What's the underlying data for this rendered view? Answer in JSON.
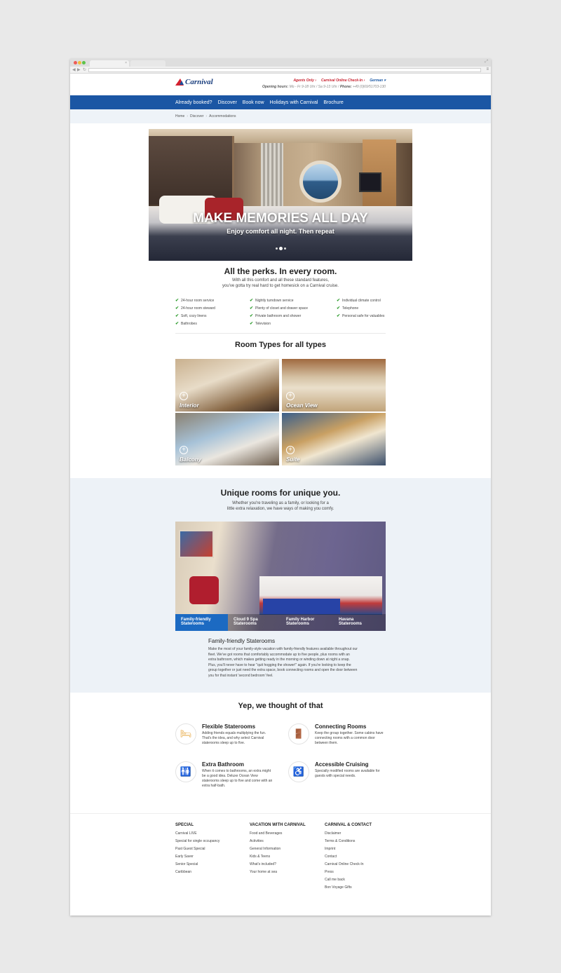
{
  "browser": {
    "tab_close": "×",
    "expand_glyph": "⤢",
    "back_glyph": "◀",
    "forward_glyph": "▶",
    "reload_glyph": "↻",
    "menu_glyph": "≡"
  },
  "header": {
    "logo_text": "Carnival",
    "links": [
      "Agents Only ›",
      "Carnival Online Check-In ›",
      "German ▾"
    ],
    "hours_label": "Opening hours:",
    "hours_text": "Mo - Fr 9-18 Uhr / Sa 9-13 Uhr",
    "phone_label": "Phone:",
    "phone": "+49 (0)69/51703-130"
  },
  "nav": [
    "Already booked?",
    "Discover",
    "Book now",
    "Holidays with Carnival",
    "Brochure"
  ],
  "breadcrumb": [
    "Home",
    "Discover",
    "Accommodations"
  ],
  "breadcrumb_sep": "›",
  "hero": {
    "title": "MAKE MEMORIES ALL DAY",
    "subtitle": "Enjoy comfort all night. Then repeat",
    "slides": 3,
    "active_slide": 2
  },
  "perks": {
    "title": "All the perks. In every room.",
    "desc_line1": "With all this comfort and all these standard features,",
    "desc_line2": "you've gotta try real hard to get homesick on a Carnival cruise.",
    "check": "✔",
    "items": [
      "24-hour room service",
      "Nightly turndown service",
      "Individual climate control",
      "24-hour room steward",
      "Plenty of closet and drawer space",
      "Telephone",
      "Soft, cozy linens",
      "Private bathroom and shower",
      "Personal safe for valuables",
      "Bathrobes",
      "Television",
      ""
    ]
  },
  "room_types": {
    "title": "Room Types for all types",
    "plus": "+",
    "rooms": [
      "Interior",
      "Ocean View",
      "Balcony",
      "Suite"
    ]
  },
  "unique": {
    "title": "Unique rooms for unique you.",
    "desc_line1": "Whether you're traveling as a family, or looking for a",
    "desc_line2": "little extra relaxation, we have ways of making you comfy.",
    "tabs": [
      {
        "line1": "Family-friendly",
        "line2": "Staterooms"
      },
      {
        "line1": "Cloud 9 Spa",
        "line2": "Staterooms"
      },
      {
        "line1": "Family Harbor",
        "line2": "Staterooms"
      },
      {
        "line1": "Havana",
        "line2": "Staterooms"
      }
    ],
    "active_tab": 0,
    "subtitle": "Family-friendly Staterooms",
    "text": "Make the most of your family-style vacation with family-friendly features available throughout our fleet. We've got rooms that comfortably accommodate up to five people, plus rooms with an extra bathroom, which makes getting ready in the morning or winding down at night a snap. Plus, you'll never have to hear \"quit hogging the shower!\" again. If you're looking to keep the group together or just need the extra space, book connecting rooms and open the door between you for that instant 'second bedroom' feel."
  },
  "features": {
    "title": "Yep, we thought of that",
    "items": [
      {
        "icon": "bed-icon",
        "glyph": "🛏",
        "title": "Flexible Staterooms",
        "text": "Adding friends equals multiplying the fun. That's the idea, and why select Carnival staterooms sleep up to five."
      },
      {
        "icon": "door-icon",
        "glyph": "🚪",
        "title": "Connecting Rooms",
        "text": "Keep the group together. Some cabins have connecting rooms with a common door between them."
      },
      {
        "icon": "restroom-icon",
        "glyph": "🚻",
        "title": "Extra Bathroom",
        "text": "When it comes to bathrooms, an extra might be a good idea. Deluxe Ocean View staterooms sleep up to five and come with an extra half-bath."
      },
      {
        "icon": "wheelchair-icon",
        "glyph": "♿",
        "title": "Accessible Cruising",
        "text": "Specially modified rooms are available for guests with special needs."
      }
    ]
  },
  "footer": {
    "columns": [
      {
        "title": "SPECIAL",
        "links": [
          "Carnival LIVE",
          "Special for single occupancy",
          "Past Guest Special",
          "Early Saver",
          "Senior Special",
          "Caribbean"
        ]
      },
      {
        "title": "VACATION WITH CARNIVAL",
        "links": [
          "Food and Beverages",
          "Activities",
          "General Information",
          "Kids & Teens",
          "What's included?",
          "Your home at sea"
        ]
      },
      {
        "title": "CARNIVAL & CONTACT",
        "links": [
          "Disclaimer",
          "Terms & Conditions",
          "Imprint",
          "Contact",
          "Carnival Online Check-In",
          "Press",
          "Call me back",
          "Bon Voyage Gifts"
        ]
      }
    ]
  },
  "colors": {
    "nav_blue": "#1b56a4",
    "brand_red": "#c8202e",
    "tab_active": "#1c6ac2",
    "check_green": "#2a9a2a",
    "icon_orange": "#e5a43a"
  }
}
